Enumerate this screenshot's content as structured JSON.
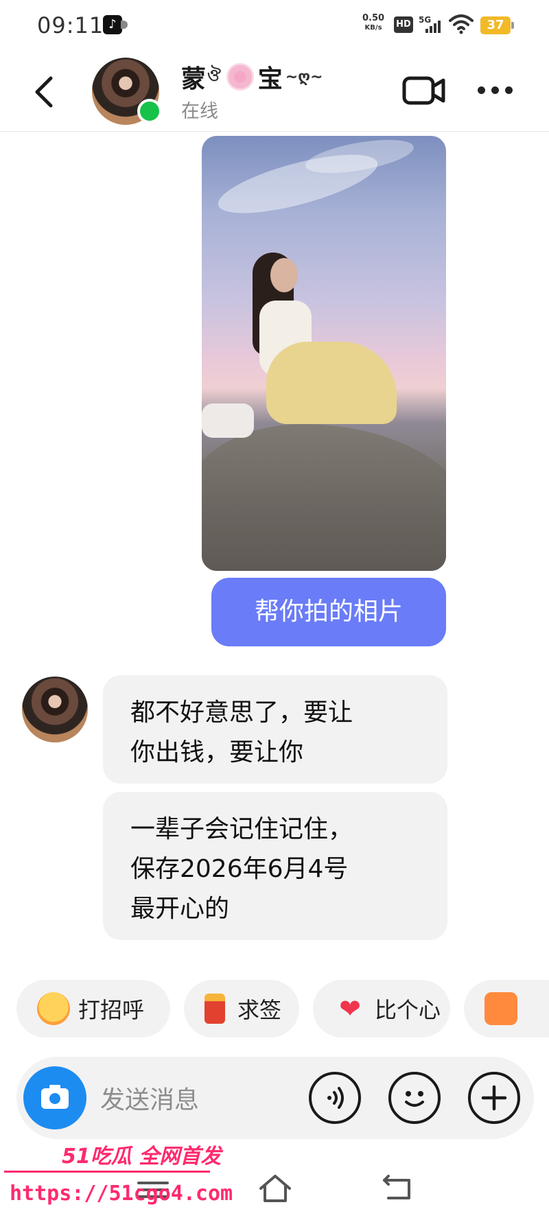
{
  "status_bar": {
    "time": "09:11",
    "speed_value": "0.50",
    "speed_unit": "KB/s",
    "hd": "HD",
    "network": "5G",
    "battery": "37"
  },
  "header": {
    "contact_name": "蒙宝",
    "presence": "在线",
    "accent_online": "#17c24a"
  },
  "messages": {
    "outgoing_text": "帮你拍的相片",
    "incoming_1": "都不好意思了，要让\n你出钱，要让你",
    "incoming_2": "一辈子会记住记住，\n保存2026年6月4号\n最开心的"
  },
  "quick_replies": [
    {
      "label": "打招呼",
      "icon": "smiley-wave-icon"
    },
    {
      "label": "求签",
      "icon": "fortune-stick-icon"
    },
    {
      "label": "比个心",
      "icon": "heart-icon"
    },
    {
      "label": "",
      "icon": "group-photo-icon"
    }
  ],
  "input": {
    "placeholder": "发送消息"
  },
  "watermark": {
    "brand": "51吃瓜 全网首发",
    "url": "https://51cgo4.com"
  },
  "colors": {
    "outgoing_bubble": "#6a7cf7",
    "incoming_bubble": "#f2f2f3",
    "camera_button": "#1d8cf0",
    "watermark": "#ff2a6d"
  }
}
